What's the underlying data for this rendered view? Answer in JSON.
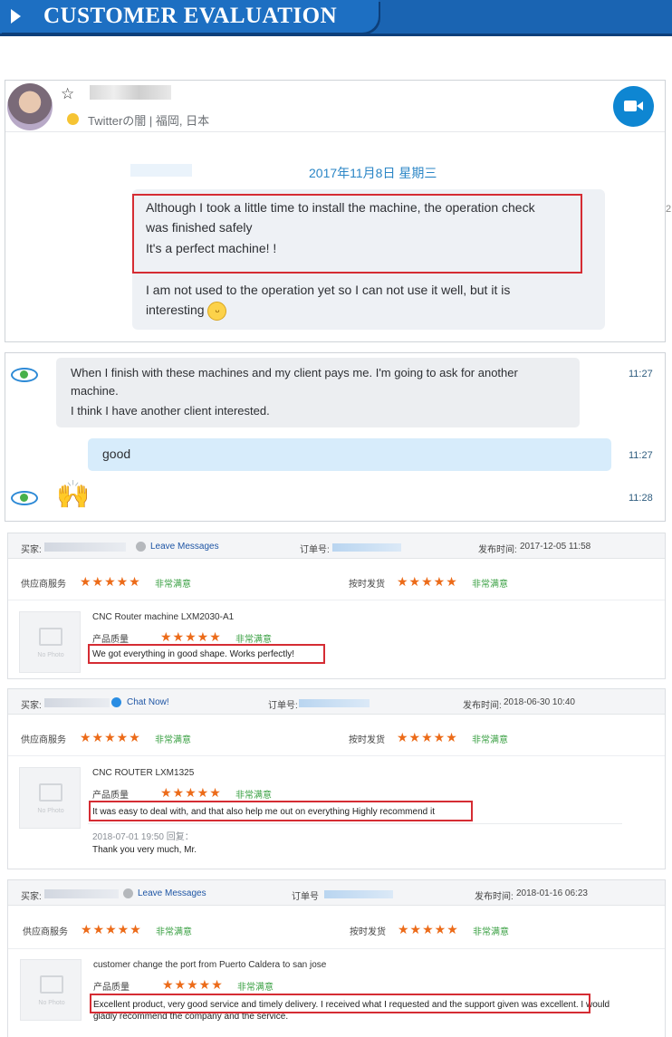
{
  "banner": {
    "title": "CUSTOMER EVALUATION",
    "brand_color": "#1a64b2"
  },
  "chat1": {
    "location": "Twitterの闇 | 福岡, 日本",
    "date": "2017年11月8日 星期三",
    "messages": [
      "Although I took a little time to install the machine, the operation check",
      "was finished safely",
      "It's a perfect machine! !",
      "I am not used to the operation yet so I can not use it well, but it is",
      "interesting"
    ],
    "side_mark": "2"
  },
  "chat2": {
    "messages": [
      {
        "lines": [
          "When I finish with these machines and my client pays me. I'm going to ask for another",
          "machine.",
          "I think I have another client interested."
        ],
        "time": "11:27"
      },
      {
        "lines": [
          "good"
        ],
        "time": "11:27"
      },
      {
        "emoji": "🙌",
        "time": "11:28"
      }
    ]
  },
  "labels": {
    "buyer": "买家:",
    "order": "订单号:",
    "published": "发布时间:",
    "supplier_service": "供应商服务",
    "on_time": "按时发货",
    "quality": "产品质量",
    "very_satisfied": "非常满意",
    "no_photo": "No Photo",
    "stars": "★★★★★"
  },
  "reviews": [
    {
      "action": "Leave Messages",
      "order_label": "订单号:",
      "published": "2017-12-05 11:58",
      "product": "CNC Router machine LXM2030-A1",
      "text": "We got everything in good shape. Works perfectly!"
    },
    {
      "action": "Chat Now!",
      "order_label": "订单号:",
      "published": "2018-06-30 10:40",
      "product": "CNC ROUTER LXM1325",
      "text": "It was easy to deal with, and that also help me out on everything Highly recommend it",
      "reply_meta": "2018-07-01 19:50   回复：",
      "reply": "Thank you very much, Mr."
    },
    {
      "action": "Leave Messages",
      "order_label": "订单号",
      "published": "2018-01-16 06:23",
      "product": "customer change the port from Puerto Caldera to san jose",
      "text": "Excellent product, very good service and timely delivery. I received what I requested and the support given was excellent. I would",
      "text2": "gladly recommend the company and the service."
    }
  ]
}
